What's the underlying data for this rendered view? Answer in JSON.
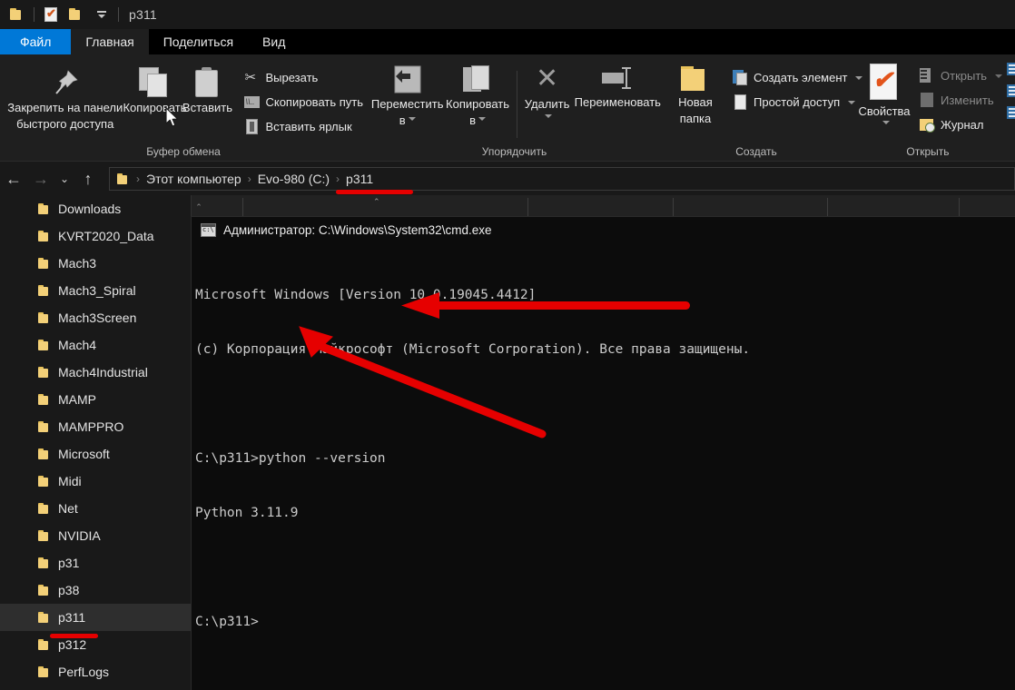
{
  "window": {
    "title": "p311",
    "quick_access": [
      {
        "name": "folder-icon",
        "label": "Проводник"
      },
      {
        "name": "properties-icon",
        "label": "Свойства"
      },
      {
        "name": "new-folder-icon",
        "label": "Новая папка"
      },
      {
        "name": "customize-icon",
        "label": "Настройка панели быстрого доступа"
      }
    ]
  },
  "tabs": [
    {
      "id": "file",
      "label": "Файл"
    },
    {
      "id": "home",
      "label": "Главная"
    },
    {
      "id": "share",
      "label": "Поделиться"
    },
    {
      "id": "view",
      "label": "Вид"
    }
  ],
  "ribbon": {
    "groups": [
      {
        "id": "clipboard",
        "label": "Буфер обмена",
        "big": [
          {
            "id": "pin",
            "icon": "pin-icon",
            "label_line1": "Закрепить на панели",
            "label_line2": "быстрого доступа"
          },
          {
            "id": "copy",
            "icon": "copy-icon",
            "label_line1": "Копировать",
            "label_line2": ""
          },
          {
            "id": "paste",
            "icon": "paste-icon",
            "label_line1": "Вставить",
            "label_line2": ""
          }
        ],
        "small": [
          {
            "id": "cut",
            "icon": "scissors-icon",
            "label": "Вырезать"
          },
          {
            "id": "copy-path",
            "icon": "copy-path-icon",
            "label": "Скопировать путь"
          },
          {
            "id": "paste-shortcut",
            "icon": "paste-shortcut-icon",
            "label": "Вставить ярлык"
          }
        ]
      },
      {
        "id": "organize",
        "label": "Упорядочить",
        "big": [
          {
            "id": "move-to",
            "icon": "move-to-icon",
            "label_line1": "Переместить",
            "label_line2": "в"
          },
          {
            "id": "copy-to",
            "icon": "copy-to-icon",
            "label_line1": "Копировать",
            "label_line2": "в"
          },
          {
            "id": "delete",
            "icon": "delete-icon",
            "label_line1": "Удалить",
            "label_line2": ""
          },
          {
            "id": "rename",
            "icon": "rename-icon",
            "label_line1": "Переименовать",
            "label_line2": ""
          }
        ]
      },
      {
        "id": "new",
        "label": "Создать",
        "big": [
          {
            "id": "new-folder",
            "icon": "new-folder-icon",
            "label_line1": "Новая",
            "label_line2": "папка"
          }
        ],
        "small": [
          {
            "id": "new-item",
            "icon": "new-item-icon",
            "label": "Создать элемент"
          },
          {
            "id": "easy-access",
            "icon": "easy-access-icon",
            "label": "Простой доступ"
          }
        ]
      },
      {
        "id": "open",
        "label": "Открыть",
        "big": [
          {
            "id": "properties",
            "icon": "properties-icon",
            "label_line1": "Свойства",
            "label_line2": ""
          }
        ],
        "small": [
          {
            "id": "open",
            "icon": "open-icon",
            "label": "Открыть"
          },
          {
            "id": "edit",
            "icon": "edit-icon",
            "label": "Изменить"
          },
          {
            "id": "history",
            "icon": "history-icon",
            "label": "Журнал"
          }
        ]
      }
    ]
  },
  "address": {
    "back": "←",
    "forward": "→",
    "recent": "⌄",
    "up": "↑",
    "crumbs": [
      "Этот компьютер",
      "Evo-980 (C:)",
      "p311"
    ],
    "separator": "›"
  },
  "nav_pane": {
    "items": [
      {
        "label": "Downloads",
        "selected": false
      },
      {
        "label": "KVRT2020_Data",
        "selected": false
      },
      {
        "label": "Mach3",
        "selected": false
      },
      {
        "label": "Mach3_Spiral",
        "selected": false
      },
      {
        "label": "Mach3Screen",
        "selected": false
      },
      {
        "label": "Mach4",
        "selected": false
      },
      {
        "label": "Mach4Industrial",
        "selected": false
      },
      {
        "label": "MAMP",
        "selected": false
      },
      {
        "label": "MAMPPRO",
        "selected": false
      },
      {
        "label": "Microsoft",
        "selected": false
      },
      {
        "label": "Midi",
        "selected": false
      },
      {
        "label": "Net",
        "selected": false
      },
      {
        "label": "NVIDIA",
        "selected": false
      },
      {
        "label": "p31",
        "selected": false
      },
      {
        "label": "p38",
        "selected": false
      },
      {
        "label": "p311",
        "selected": true
      },
      {
        "label": "p312",
        "selected": false
      },
      {
        "label": "PerfLogs",
        "selected": false
      }
    ]
  },
  "console": {
    "title": "Администратор: C:\\Windows\\System32\\cmd.exe",
    "lines": [
      "Microsoft Windows [Version 10.0.19045.4412]",
      "(c) Корпорация Майкрософт (Microsoft Corporation). Все права защищены.",
      "",
      "C:\\p311>python --version",
      "Python 3.11.9",
      "",
      "C:\\p311>"
    ]
  },
  "annotations": {
    "color": "#e60000",
    "marks": [
      {
        "id": "breadcrumb-underline",
        "kind": "underline",
        "target": "p311 breadcrumb"
      },
      {
        "id": "navpane-underline",
        "kind": "underline",
        "target": "p311 folder in nav pane"
      },
      {
        "id": "command-arrow",
        "kind": "arrow",
        "target": "python --version command"
      },
      {
        "id": "version-arrow",
        "kind": "arrow",
        "target": "Python 3.11.9 output"
      }
    ]
  },
  "colors": {
    "accent": "#0078d7",
    "window_bg": "#191919",
    "ribbon_bg": "#1f1f1f",
    "console_bg": "#0c0c0c",
    "folder": "#f3d078",
    "annotation_red": "#e60000"
  }
}
